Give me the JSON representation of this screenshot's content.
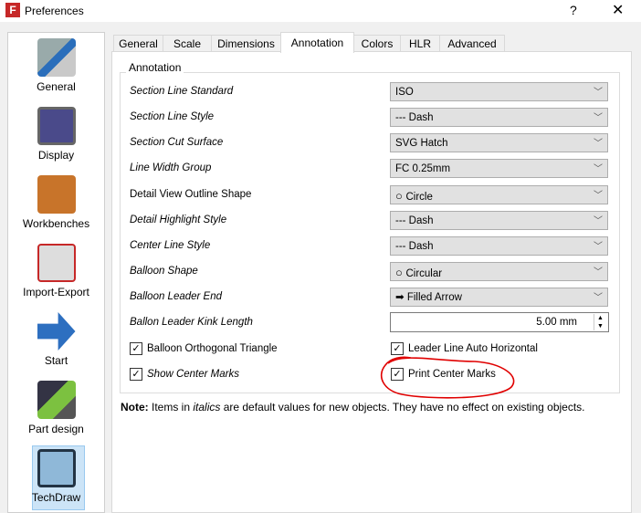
{
  "window": {
    "title": "Preferences",
    "help": "?",
    "close": "✕"
  },
  "sidebar": {
    "items": [
      {
        "label": "General",
        "icon": "wrench-screwdriver-icon"
      },
      {
        "label": "Display",
        "icon": "monitor-icon"
      },
      {
        "label": "Workbenches",
        "icon": "box-icon"
      },
      {
        "label": "Import-Export",
        "icon": "import-export-icon"
      },
      {
        "label": "Start",
        "icon": "arrow-right-icon"
      },
      {
        "label": "Part design",
        "icon": "part-design-icon"
      },
      {
        "label": "TechDraw",
        "icon": "techdraw-icon",
        "selected": true
      }
    ]
  },
  "tabs": [
    "General",
    "Scale",
    "Dimensions",
    "Annotation",
    "Colors",
    "HLR",
    "Advanced"
  ],
  "active_tab": "Annotation",
  "group": {
    "title": "Annotation",
    "rows": [
      {
        "label": "Section Line Standard",
        "italic": true,
        "value": "ISO"
      },
      {
        "label": "Section Line Style",
        "italic": true,
        "value": "--- Dash"
      },
      {
        "label": "Section Cut Surface",
        "italic": true,
        "value": "SVG Hatch"
      },
      {
        "label": "Line Width Group",
        "italic": true,
        "value": "FC 0.25mm"
      },
      {
        "label": "Detail View Outline Shape",
        "italic": false,
        "value": "Circle",
        "icon": "circle-icon"
      },
      {
        "label": "Detail Highlight Style",
        "italic": true,
        "value": "--- Dash"
      },
      {
        "label": "Center Line Style",
        "italic": true,
        "value": "--- Dash"
      },
      {
        "label": "Balloon Shape",
        "italic": true,
        "value": "Circular",
        "icon": "circle-icon"
      },
      {
        "label": "Balloon Leader End",
        "italic": true,
        "value": "Filled Arrow",
        "icon": "filled-arrow-icon"
      },
      {
        "label": "Ballon Leader Kink Length",
        "italic": true,
        "value": "5.00 mm"
      }
    ],
    "checkboxes": [
      {
        "label": "Balloon Orthogonal Triangle",
        "checked": true,
        "italic": false
      },
      {
        "label": "Leader Line Auto Horizontal",
        "checked": true,
        "italic": false
      },
      {
        "label": "Show Center Marks",
        "checked": true,
        "italic": true
      },
      {
        "label": "Print Center Marks",
        "checked": true,
        "italic": false
      }
    ]
  },
  "note": {
    "bold": "Note:",
    "pre": " Items in ",
    "italic": "italics",
    "post": " are default values for new objects. They have no effect on existing objects."
  },
  "annotation_color": "#e00000"
}
